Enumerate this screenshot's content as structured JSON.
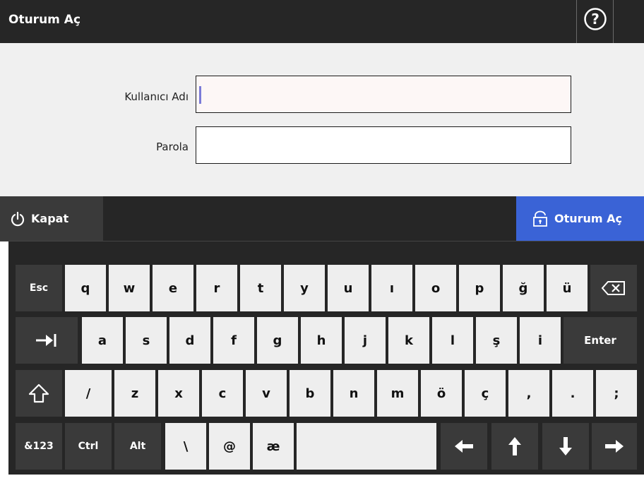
{
  "titlebar": {
    "title": "Oturum Aç",
    "help_glyph": "?"
  },
  "form": {
    "username_label": "Kullanıcı Adı",
    "username_value": "",
    "password_label": "Parola",
    "password_value": ""
  },
  "actions": {
    "shutdown_label": "Kapat",
    "login_label": "Oturum Aç"
  },
  "keyboard": {
    "row1": [
      "Esc",
      "q",
      "w",
      "e",
      "r",
      "t",
      "y",
      "u",
      "ı",
      "o",
      "p",
      "ğ",
      "ü",
      "⌫"
    ],
    "row2": [
      "⇥",
      "a",
      "s",
      "d",
      "f",
      "g",
      "h",
      "j",
      "k",
      "l",
      "ş",
      "i",
      "Enter"
    ],
    "row3": [
      "⇧",
      "/",
      "z",
      "x",
      "c",
      "v",
      "b",
      "n",
      "m",
      "ö",
      "ç",
      ",",
      ".",
      ";"
    ],
    "row4": [
      "&123",
      "Ctrl",
      "Alt",
      "\\",
      "@",
      "æ",
      "",
      "←",
      "↑",
      "↓",
      "→"
    ]
  },
  "colors": {
    "bar": "#262626",
    "form_bg": "#f0f0f0",
    "accent": "#3a63d6",
    "key_light": "#eeeeee",
    "key_dark": "#3a3a3a"
  }
}
